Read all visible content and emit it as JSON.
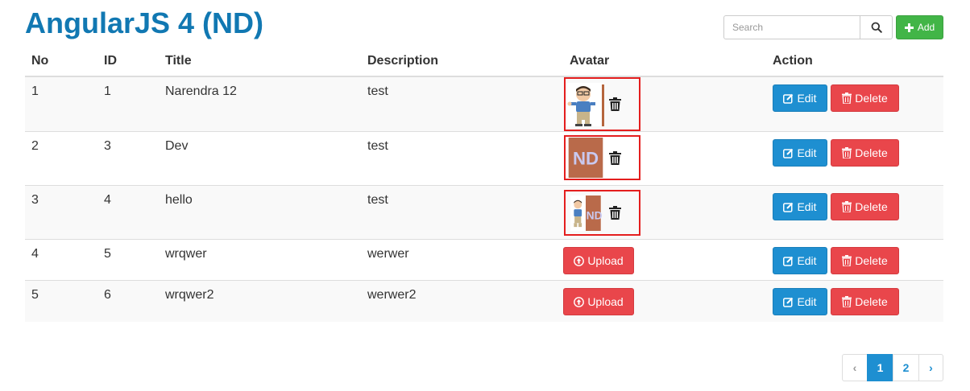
{
  "header": {
    "title": "AngularJS 4 (ND)",
    "search_placeholder": "Search",
    "add_label": "Add"
  },
  "table": {
    "columns": [
      "No",
      "ID",
      "Title",
      "Description",
      "Avatar",
      "Action"
    ],
    "rows": [
      {
        "no": "1",
        "id": "1",
        "title": "Narendra 12",
        "description": "test",
        "avatar": "image"
      },
      {
        "no": "2",
        "id": "3",
        "title": "Dev",
        "description": "test",
        "avatar": "image"
      },
      {
        "no": "3",
        "id": "4",
        "title": "hello",
        "description": "test",
        "avatar": "image"
      },
      {
        "no": "4",
        "id": "5",
        "title": "wrqwer",
        "description": "werwer",
        "avatar": "upload"
      },
      {
        "no": "5",
        "id": "6",
        "title": "wrqwer2",
        "description": "werwer2",
        "avatar": "upload"
      }
    ],
    "upload_label": "Upload",
    "edit_label": "Edit",
    "delete_label": "Delete"
  },
  "avatar_images": {
    "logo_text": "ND"
  },
  "pagination": {
    "prev": "‹",
    "pages": [
      "1",
      "2"
    ],
    "active_page": "1",
    "next": "›"
  },
  "colors": {
    "title": "#1178b2",
    "primary": "#1e8fd1",
    "danger": "#e9464b",
    "success": "#42b547",
    "avatar_border": "#e41e1e"
  }
}
